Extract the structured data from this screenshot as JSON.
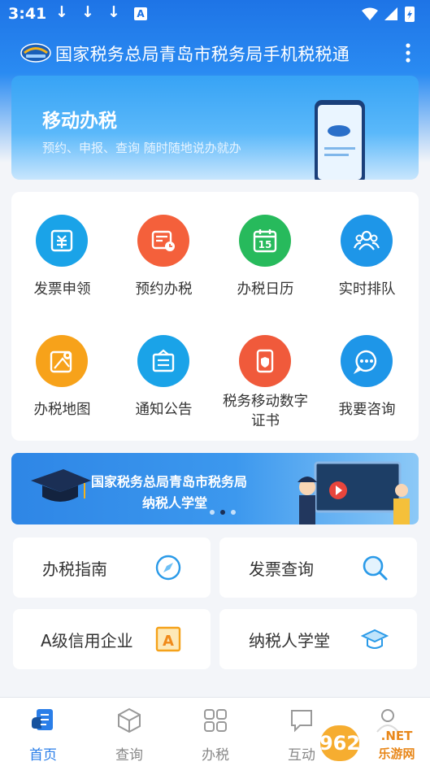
{
  "status_bar": {
    "time": "3:41",
    "download_icon": "↓",
    "a_label": "A"
  },
  "app_bar": {
    "title": "国家税务总局青岛市税务局手机税税通"
  },
  "banner": {
    "title": "移动办税",
    "subtitle": "预约、申报、查询 随时随地说办就办"
  },
  "services": [
    {
      "label": "发票申领",
      "icon": "invoice-apply-icon",
      "color": "#1aa3e8"
    },
    {
      "label": "预约办税",
      "icon": "appointment-icon",
      "color": "#f4603b"
    },
    {
      "label": "办税日历",
      "icon": "calendar-icon",
      "color": "#27ba5c",
      "day": "15"
    },
    {
      "label": "实时排队",
      "icon": "queue-icon",
      "color": "#1e96e8"
    },
    {
      "label": "办税地图",
      "icon": "map-icon",
      "color": "#f7a21a"
    },
    {
      "label": "通知公告",
      "icon": "notice-icon",
      "color": "#1aa3e8"
    },
    {
      "label": "税务移动数字证书",
      "label_line1": "税务移动数字",
      "label_line2": "证书",
      "icon": "digital-cert-icon",
      "color": "#f05a3b"
    },
    {
      "label": "我要咨询",
      "icon": "chat-icon",
      "color": "#1e96e8"
    }
  ],
  "school_banner": {
    "line1": "国家税务总局青岛市税务局",
    "line2": "纳税人学堂"
  },
  "quick_links": [
    {
      "label": "办税指南",
      "icon": "compass-icon"
    },
    {
      "label": "发票查询",
      "icon": "search-icon"
    },
    {
      "label": "A级信用企业",
      "icon": "credit-a-icon",
      "badge": "A"
    },
    {
      "label": "纳税人学堂",
      "icon": "graduation-cap-icon"
    }
  ],
  "bottom_nav": [
    {
      "label": "首页",
      "icon": "home-icon",
      "active": true
    },
    {
      "label": "查询",
      "icon": "cube-icon",
      "active": false
    },
    {
      "label": "办税",
      "icon": "grid-icon",
      "active": false
    },
    {
      "label": "互动",
      "icon": "message-icon",
      "active": false
    },
    {
      "label": "",
      "icon": "user-icon",
      "active": false
    }
  ],
  "watermark": {
    "text_main": "962",
    "text_domain": ".NET",
    "text_sub": "乐游网"
  },
  "colors": {
    "primary": "#2a7ee8",
    "header": "#1e74e6",
    "background": "#f3f5f9"
  }
}
